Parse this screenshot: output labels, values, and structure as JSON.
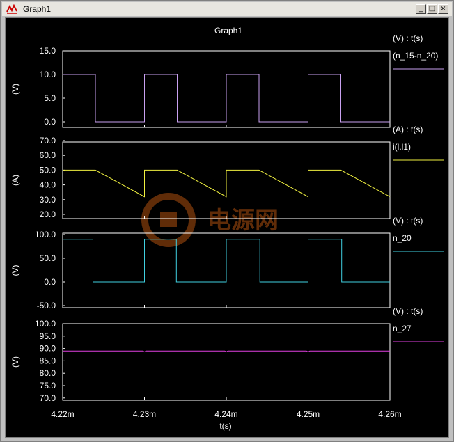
{
  "window": {
    "title": "Graph1",
    "buttons": {
      "minimize": "_",
      "maximize": "□",
      "close": "×"
    }
  },
  "graph": {
    "title": "Graph1",
    "x_axis_label": "t(s)",
    "watermark": "电源网"
  },
  "colors": {
    "background": "#000000",
    "frame": "#ffffff",
    "text": "#ffffff"
  },
  "chart_data": [
    {
      "type": "line",
      "ylabel": "(V)",
      "legend_header": "(V) : t(s)",
      "yticks": [
        "15.0",
        "10.0",
        "5.0",
        "0.0"
      ],
      "ylim": [
        -1.2,
        15.0
      ],
      "xlim": [
        4.22,
        4.26
      ],
      "x_unit": "ms",
      "series": [
        {
          "name": "(n_15-n_20)",
          "color": "#c8a0f0",
          "x": [
            4.22,
            4.224,
            4.224,
            4.23,
            4.23,
            4.234,
            4.234,
            4.24,
            4.24,
            4.244,
            4.244,
            4.25,
            4.25,
            4.254,
            4.254,
            4.26
          ],
          "y": [
            10,
            10,
            0,
            0,
            10,
            10,
            0,
            0,
            10,
            10,
            0,
            0,
            10,
            10,
            0,
            0
          ]
        }
      ]
    },
    {
      "type": "line",
      "ylabel": "(A)",
      "legend_header": "(A) : t(s)",
      "yticks": [
        "70.0",
        "60.0",
        "50.0",
        "40.0",
        "30.0",
        "20.0"
      ],
      "ylim": [
        20.0,
        70.0
      ],
      "xlim": [
        4.22,
        4.26
      ],
      "x_unit": "ms",
      "series": [
        {
          "name": "i(l.l1)",
          "color": "#f0f040",
          "x": [
            4.22,
            4.224,
            4.23,
            4.23,
            4.234,
            4.24,
            4.24,
            4.244,
            4.25,
            4.25,
            4.254,
            4.26
          ],
          "y": [
            50,
            50,
            32,
            50,
            50,
            32,
            50,
            50,
            32,
            50,
            50,
            32
          ]
        }
      ]
    },
    {
      "type": "line",
      "ylabel": "(V)",
      "legend_header": "(V) : t(s)",
      "yticks": [
        "100.0",
        "50.0",
        "0.0",
        "-50.0"
      ],
      "ylim": [
        -60.0,
        100.0
      ],
      "xlim": [
        4.22,
        4.26
      ],
      "x_unit": "ms",
      "series": [
        {
          "name": "n_20",
          "color": "#40d0e0",
          "x": [
            4.22,
            4.2237,
            4.2237,
            4.23,
            4.23,
            4.2339,
            4.2339,
            4.24,
            4.24,
            4.2441,
            4.2441,
            4.25,
            4.25,
            4.2541,
            4.2541,
            4.26
          ],
          "y": [
            90,
            90,
            0,
            0,
            90,
            90,
            0,
            0,
            90,
            90,
            0,
            0,
            90,
            90,
            0,
            0
          ]
        }
      ]
    },
    {
      "type": "line",
      "ylabel": "(V)",
      "legend_header": "(V) : t(s)",
      "yticks": [
        "100.0",
        "95.0",
        "90.0",
        "85.0",
        "80.0",
        "75.0",
        "70.0"
      ],
      "ylim": [
        69.0,
        100.0
      ],
      "xlim": [
        4.22,
        4.26
      ],
      "x_unit": "ms",
      "series": [
        {
          "name": "n_27",
          "color": "#e040e0",
          "x": [
            4.22,
            4.2298,
            4.23,
            4.2302,
            4.2398,
            4.24,
            4.2402,
            4.2498,
            4.25,
            4.2502,
            4.26
          ],
          "y": [
            89,
            89,
            88.6,
            89,
            89,
            88.6,
            89,
            89,
            88.6,
            89,
            89
          ]
        }
      ]
    }
  ],
  "x_axis": {
    "ticks": [
      4.22,
      4.23,
      4.24,
      4.25,
      4.26
    ],
    "tick_labels": [
      "4.22m",
      "4.23m",
      "4.24m",
      "4.25m",
      "4.26m"
    ]
  }
}
